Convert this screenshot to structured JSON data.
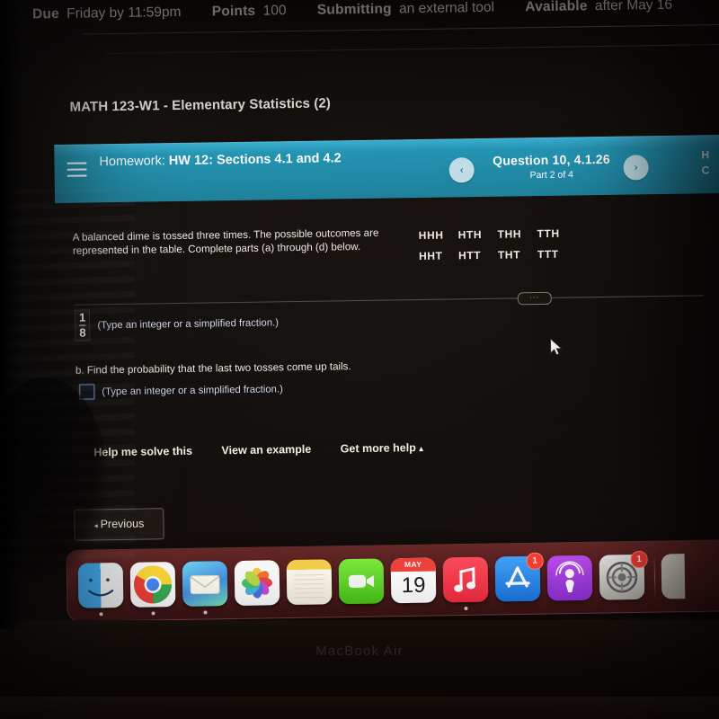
{
  "assignment_meta": [
    {
      "key": "Due",
      "value": "Friday by 11:59pm"
    },
    {
      "key": "Points",
      "value": "100"
    },
    {
      "key": "Submitting",
      "value": "an external tool"
    },
    {
      "key": "Available",
      "value": "after May 16"
    }
  ],
  "course": {
    "title": "MATH 123-W1 - Elementary Statistics (2)"
  },
  "homework_header": {
    "label": "Homework:",
    "title": "HW 12: Sections 4.1 and 4.2",
    "question": "Question 10, 4.1.26",
    "part": "Part 2 of 4",
    "prev_arrow": "‹",
    "next_arrow": "›",
    "menu_icon": "hamburger-icon",
    "cut_off_text": "HW\nSc",
    "bar_color": "#2196b6"
  },
  "problem": {
    "prompt": "A balanced dime is tossed three times. The possible outcomes are represented in the table. Complete parts (a) through (d) below.",
    "outcomes_row1": [
      "HHH",
      "HTH",
      "THH",
      "TTH"
    ],
    "outcomes_row2": [
      "HHT",
      "HTT",
      "THT",
      "TTT"
    ],
    "ellipsis": "···"
  },
  "part_a": {
    "numerator": "1",
    "denominator": "8",
    "hint": "(Type an integer or a simplified fraction.)"
  },
  "part_b": {
    "question": "b. Find the probability that the last two tosses come up tails.",
    "answer_value": "",
    "hint": "(Type an integer or a simplified fraction.)"
  },
  "help_links": [
    {
      "label": "Help me solve this",
      "caret": ""
    },
    {
      "label": "View an example",
      "caret": ""
    },
    {
      "label": "Get more help",
      "caret": "▴"
    }
  ],
  "navigation": {
    "previous_label": "Previous",
    "previous_arrow": "◂"
  },
  "dock": {
    "items": [
      {
        "name": "Finder",
        "icon": "finder-icon",
        "running": true,
        "badge": ""
      },
      {
        "name": "Google Chrome",
        "icon": "chrome-icon",
        "running": true,
        "badge": ""
      },
      {
        "name": "Mail",
        "icon": "mail-icon",
        "running": true,
        "badge": ""
      },
      {
        "name": "Photos",
        "icon": "photos-icon",
        "running": false,
        "badge": ""
      },
      {
        "name": "Notes",
        "icon": "notes-icon",
        "running": false,
        "badge": ""
      },
      {
        "name": "FaceTime",
        "icon": "facetime-icon",
        "running": false,
        "badge": ""
      },
      {
        "name": "Calendar",
        "icon": "calendar-icon",
        "running": false,
        "badge": "",
        "month": "MAY",
        "day": "19"
      },
      {
        "name": "Music",
        "icon": "music-icon",
        "running": true,
        "badge": ""
      },
      {
        "name": "App Store",
        "icon": "appstore-icon",
        "running": false,
        "badge": "1"
      },
      {
        "name": "Podcasts",
        "icon": "podcasts-icon",
        "running": false,
        "badge": ""
      },
      {
        "name": "System Preferences",
        "icon": "settings-icon",
        "running": false,
        "badge": "1"
      }
    ]
  },
  "device": {
    "label": "MacBook Air"
  }
}
